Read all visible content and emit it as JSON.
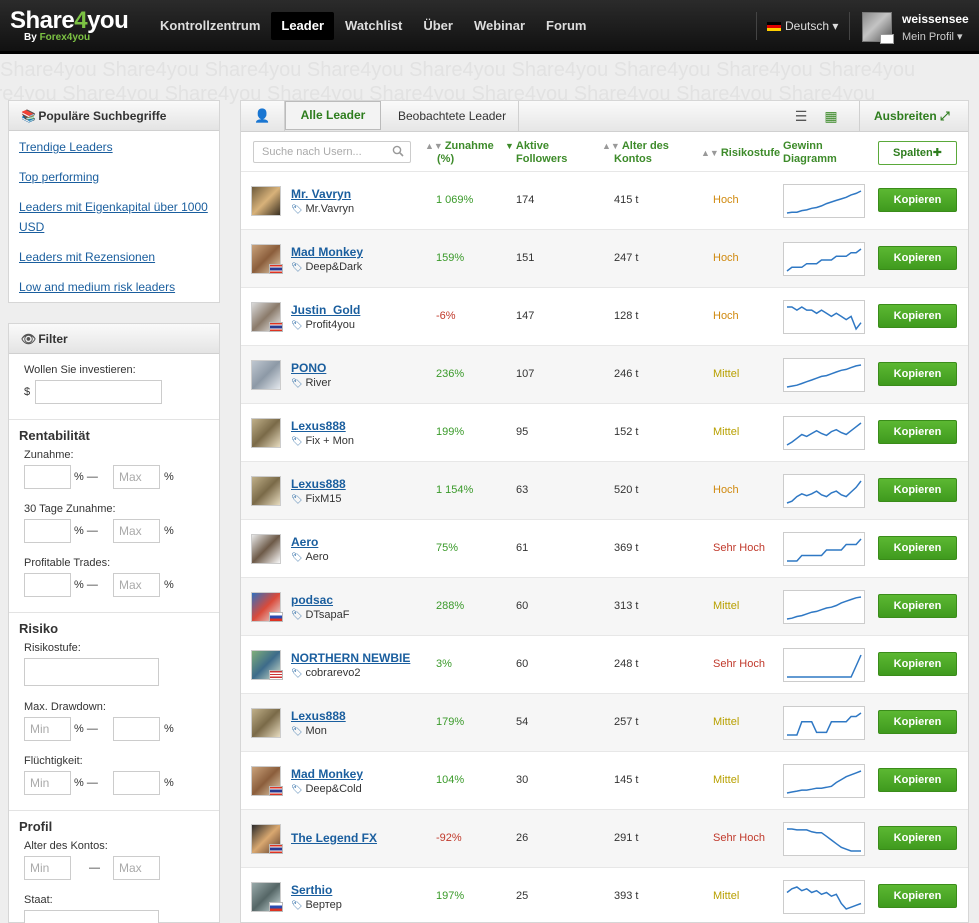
{
  "brand": {
    "name_a": "Share",
    "name_b": "4",
    "name_c": "you",
    "sub_a": "By ",
    "sub_b": "Forex4you"
  },
  "nav": [
    {
      "label": "Kontrollzentrum"
    },
    {
      "label": "Leader"
    },
    {
      "label": "Watchlist"
    },
    {
      "label": "Über"
    },
    {
      "label": "Webinar"
    },
    {
      "label": "Forum"
    }
  ],
  "language": "Deutsch",
  "user": {
    "name": "weissensee",
    "profile": "Mein Profil"
  },
  "watermark": "Share4you  Share4you  Share4you  Share4you  Share4you  Share4you  Share4you  Share4you  Share4you",
  "popular": {
    "title": "Populäre Suchbegriffe",
    "links": [
      "Trendige Leaders",
      "Top performing",
      "Leaders mit Eigenkapital über 1000 USD",
      "Leaders mit Rezensionen",
      "Low and medium risk leaders"
    ]
  },
  "filter": {
    "title": "Filter",
    "invest_label": "Wollen Sie investieren:",
    "currency": "$",
    "rent_title": "Rentabilität",
    "gain_label": "Zunahme:",
    "gain30_label": "30 Tage Zunahme:",
    "profit_label": "Profitable Trades:",
    "risk_title": "Risiko",
    "risk_label": "Risikostufe:",
    "dd_label": "Max. Drawdown:",
    "vol_label": "Flüchtigkeit:",
    "profile_title": "Profil",
    "age_label": "Alter des Kontos:",
    "country_label": "Staat:",
    "min_ph": "Min",
    "max_ph": "Max",
    "pct": "%",
    "dash": "—"
  },
  "tabs": {
    "all": "Alle Leader",
    "watched": "Beobachtete Leader",
    "expand": "Ausbreiten"
  },
  "table": {
    "search_placeholder": "Suche nach Usern...",
    "col_gain": "Zunahme",
    "col_gain2": "(%)",
    "col_followers": "Aktive",
    "col_followers2": "Followers",
    "col_age": "Alter des",
    "col_age2": "Kontos",
    "col_risk": "Risikostufe",
    "col_chart": "Gewinn",
    "col_chart2": "Diagramm",
    "columns_button": "Spalten",
    "copy_label": "Kopieren"
  },
  "colors": {
    "positive": "#3a9a2a",
    "negative": "#c0392b",
    "risk_hoch": "#d08a10",
    "risk_mittel": "#b8a000",
    "risk_sehr_hoch": "#c0392b",
    "spark": "#2f78c4"
  },
  "leaders": [
    {
      "name": "Mr. Vavryn",
      "tag": "Mr.Vavryn",
      "gain": "1 069%",
      "sign": "pos",
      "followers": "174",
      "age": "415 t",
      "risk": "Hoch",
      "risk_key": "hoch",
      "flag": "",
      "spark": [
        2,
        3,
        3,
        5,
        6,
        8,
        9,
        11,
        14,
        16,
        18,
        20,
        22,
        25,
        27,
        30
      ]
    },
    {
      "name": "Mad Monkey",
      "tag": "Deep&Dark",
      "gain": "159%",
      "sign": "pos",
      "followers": "151",
      "age": "247 t",
      "risk": "Hoch",
      "risk_key": "hoch",
      "flag": "th",
      "spark": [
        2,
        3,
        3,
        3,
        4,
        4,
        4,
        5,
        5,
        5,
        6,
        6,
        6,
        7,
        7,
        8
      ]
    },
    {
      "name": "Justin_Gold",
      "tag": "Profit4you",
      "gain": "-6%",
      "sign": "neg",
      "followers": "147",
      "age": "128 t",
      "risk": "Hoch",
      "risk_key": "hoch",
      "flag": "th",
      "spark": [
        18,
        18,
        17,
        18,
        17,
        17,
        16,
        17,
        16,
        15,
        16,
        15,
        14,
        15,
        11,
        13
      ]
    },
    {
      "name": "PONO",
      "tag": "River",
      "gain": "236%",
      "sign": "pos",
      "followers": "107",
      "age": "246 t",
      "risk": "Mittel",
      "risk_key": "mittel",
      "flag": "",
      "spark": [
        2,
        3,
        4,
        6,
        8,
        10,
        12,
        14,
        15,
        17,
        19,
        21,
        22,
        24,
        26,
        27
      ]
    },
    {
      "name": "Lexus888",
      "tag": "Fix + Mon",
      "gain": "199%",
      "sign": "pos",
      "followers": "95",
      "age": "152 t",
      "risk": "Mittel",
      "risk_key": "mittel",
      "flag": "",
      "spark": [
        3,
        6,
        10,
        14,
        12,
        15,
        18,
        15,
        13,
        17,
        19,
        16,
        14,
        18,
        22,
        26
      ]
    },
    {
      "name": "Lexus888",
      "tag": "FixM15",
      "gain": "1 154%",
      "sign": "pos",
      "followers": "63",
      "age": "520 t",
      "risk": "Hoch",
      "risk_key": "hoch",
      "flag": "",
      "spark": [
        3,
        5,
        10,
        13,
        11,
        13,
        16,
        12,
        10,
        14,
        16,
        12,
        10,
        15,
        20,
        27
      ]
    },
    {
      "name": "Aero",
      "tag": "Aero",
      "gain": "75%",
      "sign": "pos",
      "followers": "61",
      "age": "369 t",
      "risk": "Sehr Hoch",
      "risk_key": "sehr_hoch",
      "flag": "",
      "spark": [
        3,
        3,
        3,
        4,
        4,
        4,
        4,
        4,
        5,
        5,
        5,
        5,
        6,
        6,
        6,
        7
      ]
    },
    {
      "name": "podsac",
      "tag": "DTsapaF",
      "gain": "288%",
      "sign": "pos",
      "followers": "60",
      "age": "313 t",
      "risk": "Mittel",
      "risk_key": "mittel",
      "flag": "ru",
      "spark": [
        2,
        3,
        5,
        6,
        8,
        10,
        11,
        13,
        15,
        16,
        18,
        21,
        23,
        25,
        27,
        28
      ]
    },
    {
      "name": "NORTHERN NEWBIE",
      "tag": "cobrarevo2",
      "gain": "3%",
      "sign": "pos",
      "followers": "60",
      "age": "248 t",
      "risk": "Sehr Hoch",
      "risk_key": "sehr_hoch",
      "flag": "us",
      "spark": [
        4,
        4,
        4,
        4,
        4,
        4,
        4,
        4,
        4,
        4,
        4,
        4,
        4,
        4,
        5,
        6
      ]
    },
    {
      "name": "Lexus888",
      "tag": "Mon",
      "gain": "179%",
      "sign": "pos",
      "followers": "54",
      "age": "257 t",
      "risk": "Mittel",
      "risk_key": "mittel",
      "flag": "",
      "spark": [
        3,
        3,
        3,
        18,
        18,
        18,
        6,
        6,
        6,
        18,
        18,
        18,
        18,
        24,
        24,
        28
      ]
    },
    {
      "name": "Mad Monkey",
      "tag": "Deep&Cold",
      "gain": "104%",
      "sign": "pos",
      "followers": "30",
      "age": "145 t",
      "risk": "Mittel",
      "risk_key": "mittel",
      "flag": "th",
      "spark": [
        3,
        4,
        5,
        6,
        6,
        7,
        8,
        8,
        9,
        10,
        14,
        17,
        20,
        22,
        24,
        26
      ]
    },
    {
      "name": "The Legend FX",
      "tag": "",
      "gain": "-92%",
      "sign": "neg",
      "followers": "26",
      "age": "291 t",
      "risk": "Sehr Hoch",
      "risk_key": "sehr_hoch",
      "flag": "th",
      "spark": [
        28,
        28,
        27,
        27,
        27,
        25,
        24,
        24,
        20,
        16,
        12,
        8,
        6,
        4,
        4,
        4
      ]
    },
    {
      "name": "Serthio",
      "tag": "Вертер",
      "gain": "197%",
      "sign": "pos",
      "followers": "25",
      "age": "393 t",
      "risk": "Mittel",
      "risk_key": "mittel",
      "flag": "ru",
      "spark": [
        14,
        16,
        17,
        15,
        16,
        14,
        15,
        13,
        14,
        12,
        13,
        8,
        5,
        6,
        7,
        8
      ]
    }
  ]
}
